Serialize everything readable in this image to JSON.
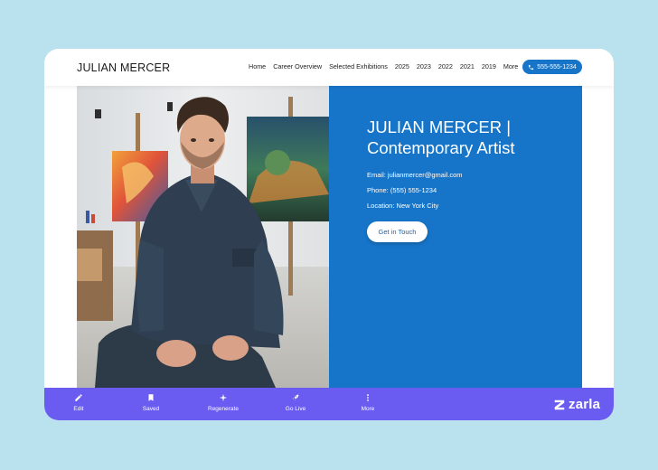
{
  "nav": {
    "brand": "JULIAN MERCER",
    "items": [
      "Home",
      "Career Overview",
      "Selected Exhibitions",
      "2025",
      "2023",
      "2022",
      "2021",
      "2019",
      "More"
    ],
    "phone_button": "555-555-1234"
  },
  "hero": {
    "title_line1": "JULIAN MERCER |",
    "title_line2": "Contemporary Artist",
    "email": "Email: julianmercer@gmail.com",
    "phone": "Phone: (555) 555-1234",
    "location": "Location: New York City",
    "cta": "Get in Touch"
  },
  "toolbar": {
    "items": [
      "Edit",
      "Saved",
      "Regenerate",
      "Go Live",
      "More"
    ],
    "logo": "zarla"
  },
  "colors": {
    "background": "#b9e1ee",
    "primary_blue": "#1775c9",
    "toolbar_purple": "#6a5cf0"
  }
}
